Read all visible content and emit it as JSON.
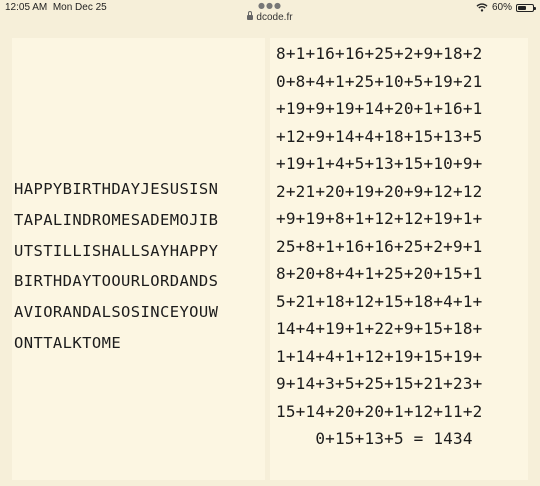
{
  "status_bar": {
    "time": "12:05 AM",
    "date": "Mon Dec 25",
    "url": "dcode.fr",
    "battery_percent": "60%",
    "battery_level": 0.6
  },
  "message_lines": [
    "HAPPYBIRTHDAYJESUSISN",
    "TAPALINDROMESADEMOJIB",
    "UTSTILLISHALLSAYHAPPY",
    "BIRTHDAYTOOURLORDANDS",
    "AVIORANDALSOSINCEYOUW",
    "ONTTALKTOME"
  ],
  "sum_lines": [
    "8+1+16+16+25+2+9+18+2",
    "0+8+4+1+25+10+5+19+21",
    "+19+9+19+14+20+1+16+1",
    "+12+9+14+4+18+15+13+5",
    "+19+1+4+5+13+15+10+9+",
    "2+21+20+19+20+9+12+12",
    "+9+19+8+1+12+12+19+1+",
    "25+8+1+16+16+25+2+9+1",
    "8+20+8+4+1+25+20+15+1",
    "5+21+18+12+15+18+4+1+",
    "14+4+19+1+22+9+15+18+",
    "1+14+4+1+12+19+15+19+",
    "9+14+3+5+25+15+21+23+",
    "15+14+20+20+1+12+11+2",
    "    0+15+13+5 = 1434"
  ]
}
